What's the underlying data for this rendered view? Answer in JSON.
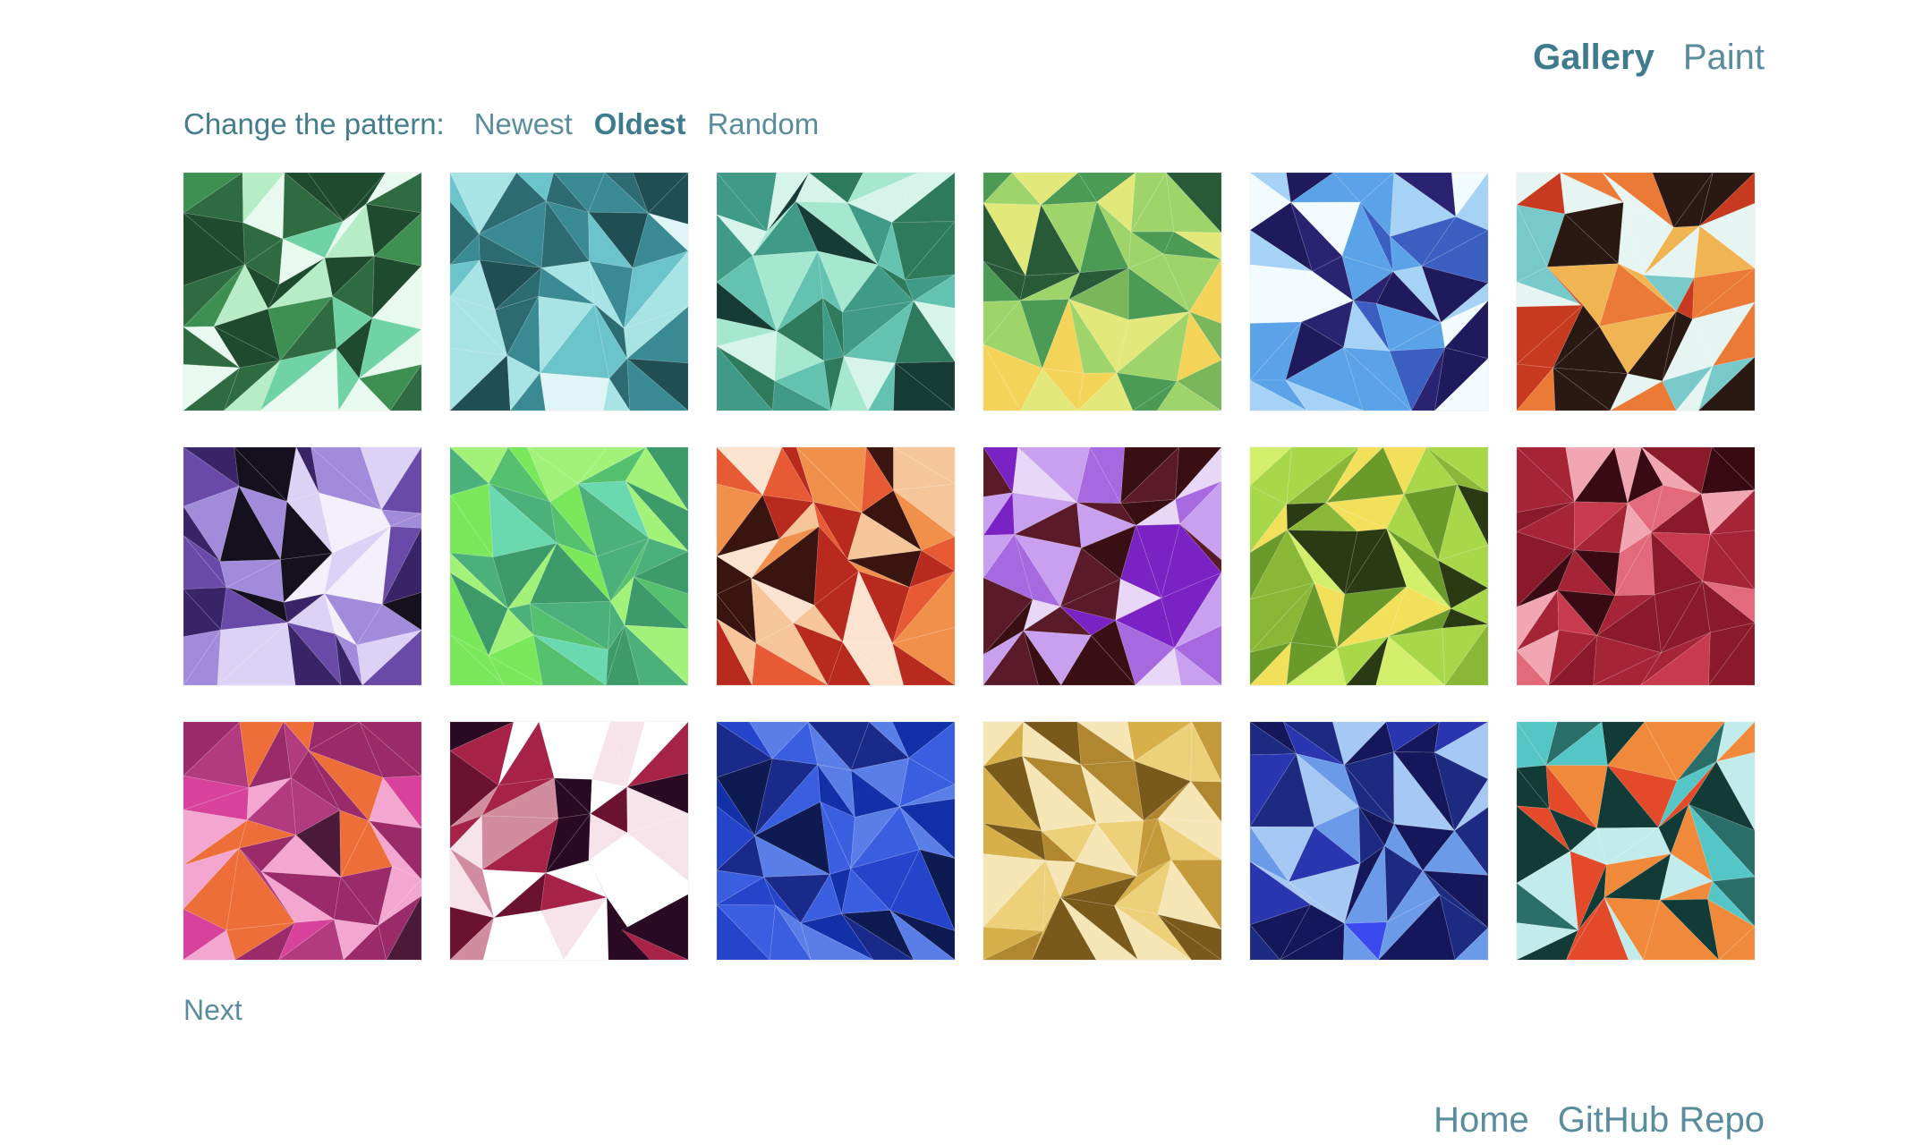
{
  "nav": {
    "gallery": "Gallery",
    "paint": "Paint"
  },
  "pattern": {
    "label": "Change the pattern:",
    "options": [
      "Newest",
      "Oldest",
      "Random"
    ],
    "selected": "Oldest"
  },
  "gallery": {
    "tiles": [
      {
        "palette": [
          "#1e4a2e",
          "#3e8f52",
          "#6fd3a6",
          "#b6ecc6",
          "#e8faef",
          "#2f6b41"
        ]
      },
      {
        "palette": [
          "#1f4e55",
          "#3a8a94",
          "#6cc4cb",
          "#a8e3e5",
          "#e0f6f6",
          "#2d6b73"
        ]
      },
      {
        "palette": [
          "#173c36",
          "#2e7a5c",
          "#63c2b0",
          "#a6e8cf",
          "#d6f4ea",
          "#3f9a86"
        ]
      },
      {
        "palette": [
          "#285a38",
          "#4b9b54",
          "#9fd46a",
          "#e3e87a",
          "#f4d458",
          "#7ab65a"
        ]
      },
      {
        "palette": [
          "#2a2372",
          "#3a5fc0",
          "#5aa3e8",
          "#a6d2f5",
          "#f2fbff",
          "#1f1a5c"
        ]
      },
      {
        "palette": [
          "#2a1812",
          "#c83a1f",
          "#ea7a35",
          "#f0b552",
          "#78c9c9",
          "#e6f4f2"
        ]
      },
      {
        "palette": [
          "#14101e",
          "#3a2468",
          "#6a4aa8",
          "#a18cdb",
          "#dcd2f6",
          "#f4f0fb"
        ]
      },
      {
        "palette": [
          "#3d9b6a",
          "#55c06e",
          "#79e85a",
          "#a2f27a",
          "#6ad9b0",
          "#4cb07a"
        ]
      },
      {
        "palette": [
          "#3a140e",
          "#b82a1e",
          "#e85a34",
          "#f0904a",
          "#f6c69a",
          "#fbe3cf"
        ]
      },
      {
        "palette": [
          "#3a0f14",
          "#7a22c4",
          "#a669e0",
          "#c8a0ef",
          "#e8d7f7",
          "#5a1a2a"
        ]
      },
      {
        "palette": [
          "#2a3a12",
          "#6a9a2a",
          "#a8d84a",
          "#d2ee6a",
          "#f2e05a",
          "#8ab836"
        ]
      },
      {
        "palette": [
          "#3a0a12",
          "#8a1a2a",
          "#c83a4e",
          "#e26a7a",
          "#f2a6b2",
          "#a52436"
        ]
      },
      {
        "palette": [
          "#4a1a38",
          "#9a2a6a",
          "#d8429a",
          "#ee6e3a",
          "#f3a6cf",
          "#b23a7e"
        ]
      },
      {
        "palette": [
          "#2a0a22",
          "#6a1230",
          "#a62246",
          "#d28ca0",
          "#f6e4ea",
          "#ffffff"
        ]
      },
      {
        "palette": [
          "#0e1a52",
          "#1230a8",
          "#2444cc",
          "#3a5ee0",
          "#5a7ee8",
          "#1a2a8a"
        ]
      },
      {
        "palette": [
          "#7a5a1a",
          "#b0872e",
          "#d8b04a",
          "#ecd07a",
          "#f6e6b6",
          "#c49a3a"
        ]
      },
      {
        "palette": [
          "#14185a",
          "#2a36b0",
          "#3a4aee",
          "#6a9ae8",
          "#a6c8f4",
          "#1c2a82"
        ]
      },
      {
        "palette": [
          "#123a36",
          "#2a6e6a",
          "#55c6c6",
          "#c2ecec",
          "#e24a2a",
          "#f08a3a"
        ]
      }
    ]
  },
  "pager": {
    "next": "Next"
  },
  "footer": {
    "home": "Home",
    "repo": "GitHub Repo"
  }
}
